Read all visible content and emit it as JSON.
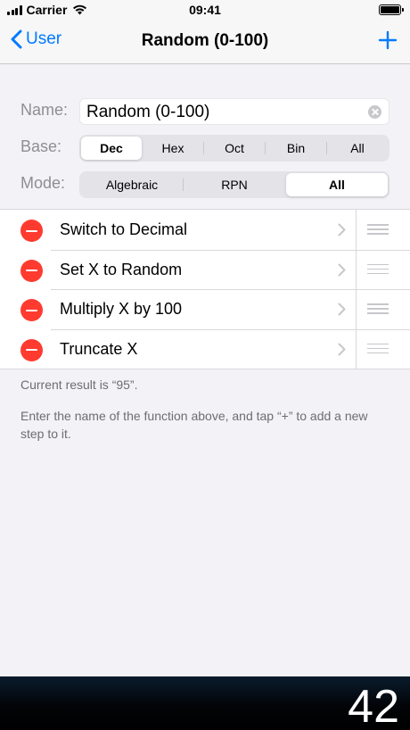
{
  "status_bar": {
    "carrier": "Carrier",
    "time": "09:41"
  },
  "nav": {
    "back_label": "User",
    "title": "Random (0-100)",
    "add_icon": "plus-icon",
    "accent_color": "#007aff"
  },
  "form": {
    "name_label": "Name:",
    "name_value": "Random (0-100)",
    "base_label": "Base:",
    "base_options": [
      "Dec",
      "Hex",
      "Oct",
      "Bin",
      "All"
    ],
    "base_selected": "Dec",
    "mode_label": "Mode:",
    "mode_options": [
      "Algebraic",
      "RPN",
      "All"
    ],
    "mode_selected": "All"
  },
  "steps": [
    {
      "label": "Switch to Decimal"
    },
    {
      "label": "Set X to Random"
    },
    {
      "label": "Multiply X by 100"
    },
    {
      "label": "Truncate X"
    }
  ],
  "notes": {
    "result": "Current result is “95”.",
    "hint": "Enter the name of the function above, and tap “+” to add a new step to it."
  },
  "display": {
    "value": "42"
  },
  "colors": {
    "delete": "#ff3b30",
    "background": "#f2f2f7"
  }
}
